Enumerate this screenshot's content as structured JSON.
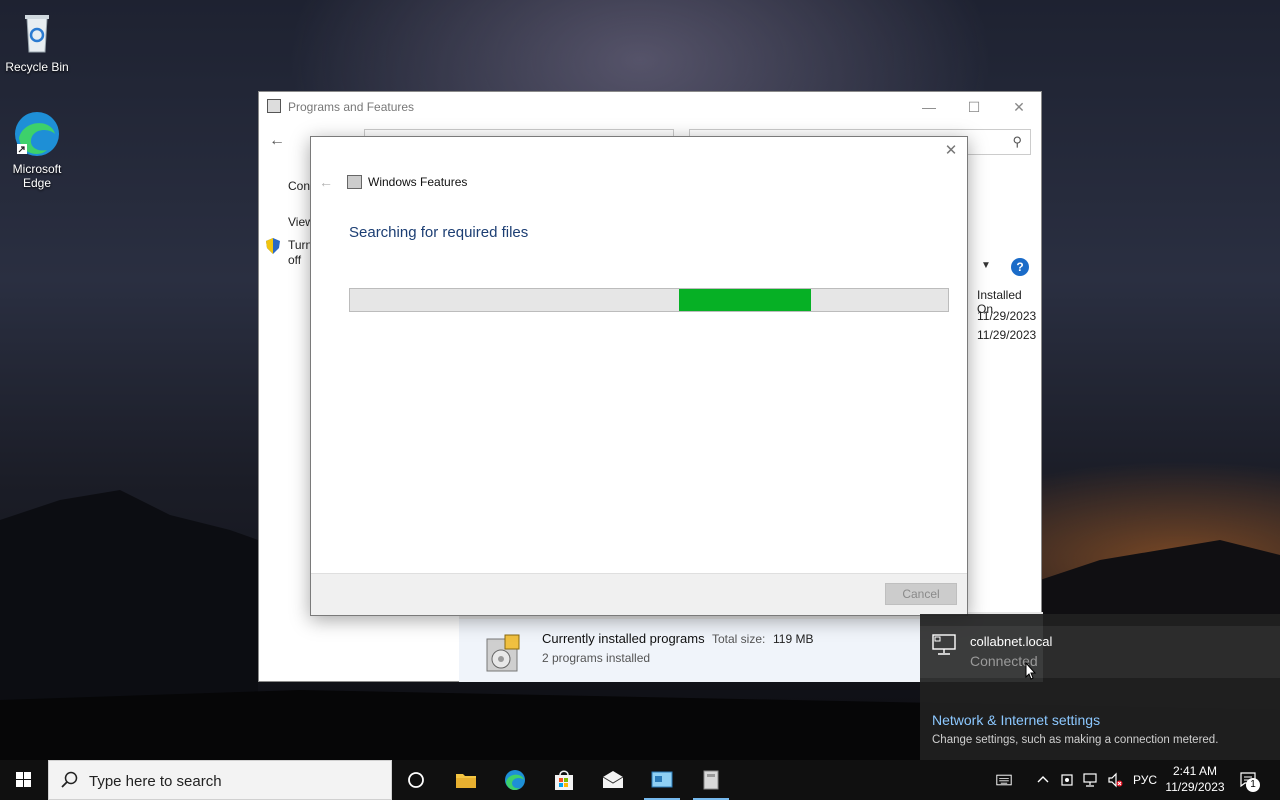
{
  "desktop": {
    "icons": [
      {
        "label": "Recycle Bin"
      },
      {
        "label": "Microsoft Edge"
      }
    ]
  },
  "programs_window": {
    "title": "Programs and Features",
    "sidebar": {
      "control_panel": "Con",
      "view": "View",
      "turn_windows_features": "Turn",
      "turn_windows_features_2": "off"
    },
    "column_header": "Installed On",
    "rows": [
      "11/29/2023",
      "11/29/2023"
    ],
    "status": {
      "title": "Currently installed programs",
      "size_label": "Total size:",
      "size_value": "119 MB",
      "count": "2 programs installed"
    }
  },
  "features_dialog": {
    "title": "Windows Features",
    "heading": "Searching for required files",
    "progress_fraction": 0.22,
    "progress_offset": 0.55,
    "cancel_label": "Cancel"
  },
  "network_flyout": {
    "network_name": "collabnet.local",
    "network_status": "Connected",
    "settings_link": "Network & Internet settings",
    "settings_desc": "Change settings, such as making a connection metered."
  },
  "taskbar": {
    "search_placeholder": "Type here to search",
    "language": "РУС",
    "time": "2:41 AM",
    "date": "11/29/2023",
    "notification_count": "1"
  },
  "colors": {
    "progress_green": "#06b025",
    "link_blue": "#8cc8ff",
    "heading_blue": "#1c3e73"
  }
}
